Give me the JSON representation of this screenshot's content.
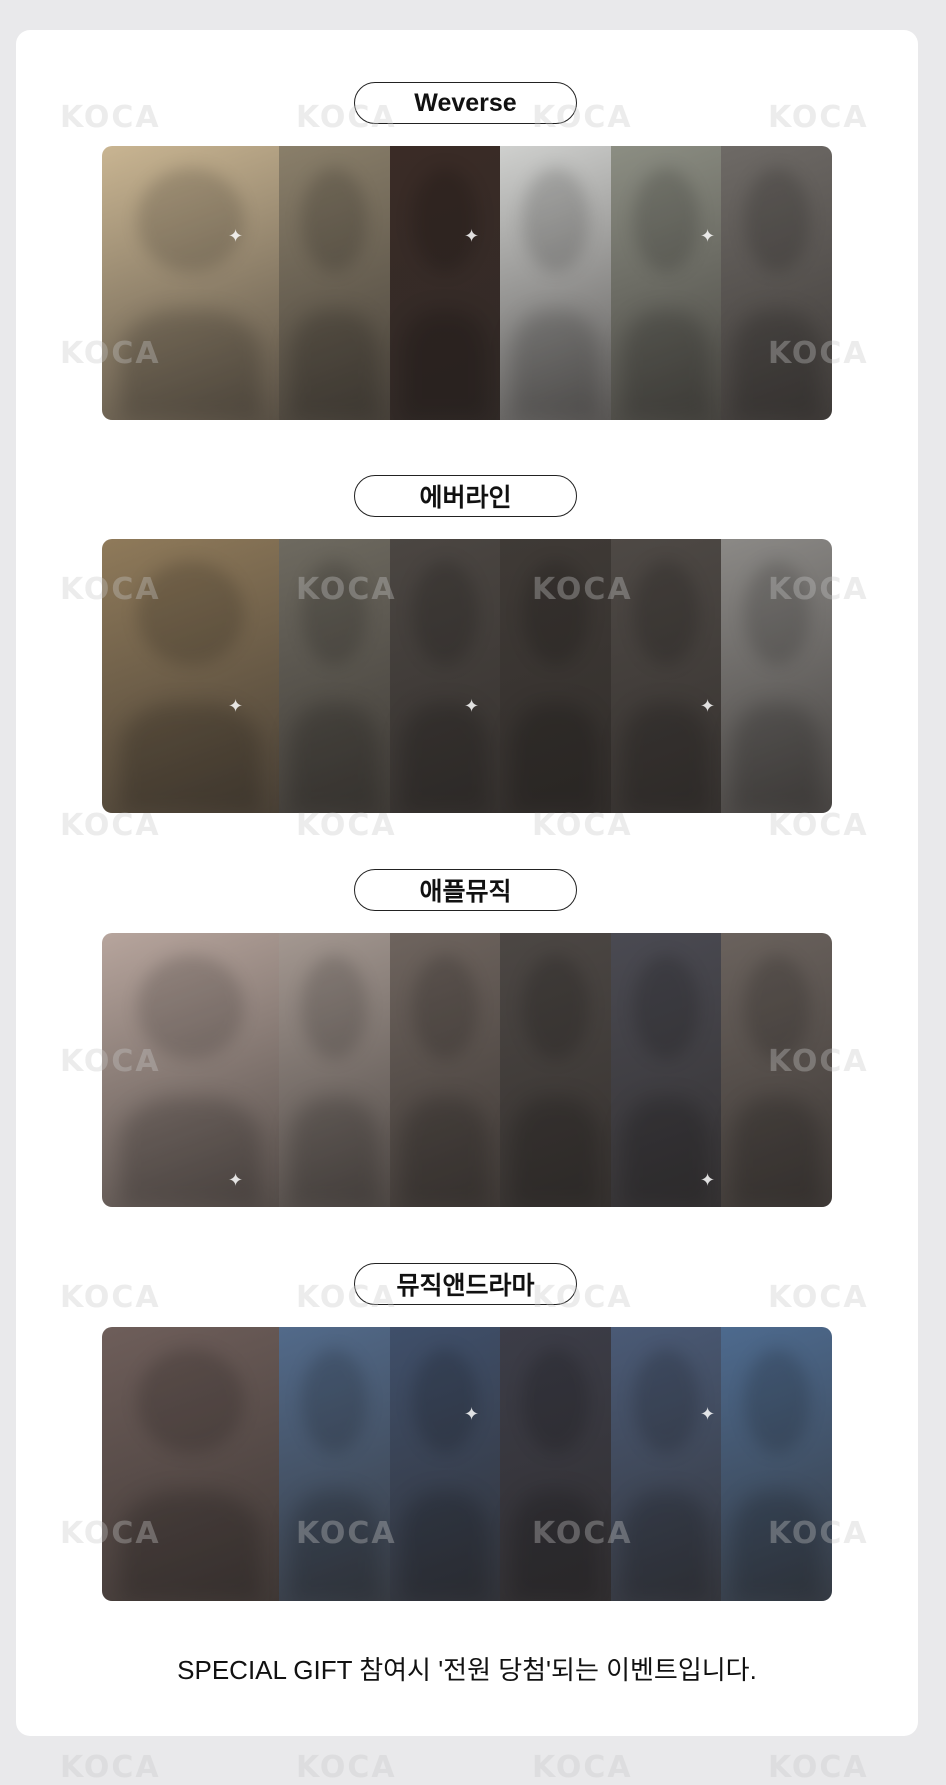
{
  "sections": [
    {
      "title": "Weverse",
      "photos": [
        "#c9b592",
        "#8a7f6a",
        "#3a2b26",
        "#cfd0ce",
        "#8c8e83",
        "#6e6a66"
      ]
    },
    {
      "title": "에버라인",
      "photos": [
        "#8f7a5a",
        "#6e6a60",
        "#4b4642",
        "#3f3a36",
        "#4e4945",
        "#8b8986"
      ]
    },
    {
      "title": "애플뮤직",
      "photos": [
        "#b7a59d",
        "#a49891",
        "#6e645e",
        "#4c4744",
        "#4a4a52",
        "#6a625d"
      ]
    },
    {
      "title": "뮤직앤드라마",
      "photos": [
        "#6e5e5a",
        "#526a8a",
        "#3f4f6a",
        "#3c3d48",
        "#4a5a76",
        "#4d6a8e"
      ]
    }
  ],
  "watermark_text": "KOCA",
  "footer": {
    "text": "SPECIAL GIFT 참여시 '전원 당첨'되는 이벤트입니다."
  }
}
